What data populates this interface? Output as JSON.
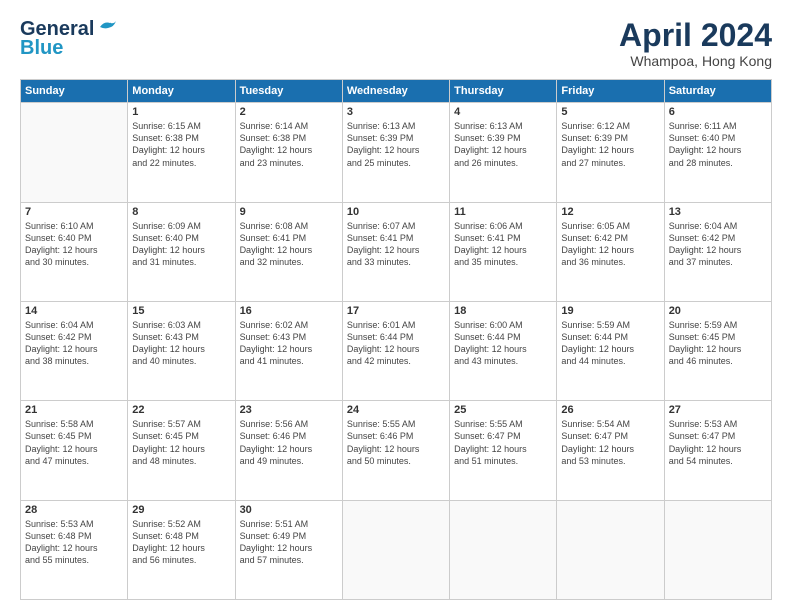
{
  "header": {
    "logo_line1": "General",
    "logo_line2": "Blue",
    "month": "April 2024",
    "location": "Whampoa, Hong Kong"
  },
  "weekdays": [
    "Sunday",
    "Monday",
    "Tuesday",
    "Wednesday",
    "Thursday",
    "Friday",
    "Saturday"
  ],
  "weeks": [
    [
      {
        "day": "",
        "info": ""
      },
      {
        "day": "1",
        "info": "Sunrise: 6:15 AM\nSunset: 6:38 PM\nDaylight: 12 hours\nand 22 minutes."
      },
      {
        "day": "2",
        "info": "Sunrise: 6:14 AM\nSunset: 6:38 PM\nDaylight: 12 hours\nand 23 minutes."
      },
      {
        "day": "3",
        "info": "Sunrise: 6:13 AM\nSunset: 6:39 PM\nDaylight: 12 hours\nand 25 minutes."
      },
      {
        "day": "4",
        "info": "Sunrise: 6:13 AM\nSunset: 6:39 PM\nDaylight: 12 hours\nand 26 minutes."
      },
      {
        "day": "5",
        "info": "Sunrise: 6:12 AM\nSunset: 6:39 PM\nDaylight: 12 hours\nand 27 minutes."
      },
      {
        "day": "6",
        "info": "Sunrise: 6:11 AM\nSunset: 6:40 PM\nDaylight: 12 hours\nand 28 minutes."
      }
    ],
    [
      {
        "day": "7",
        "info": "Sunrise: 6:10 AM\nSunset: 6:40 PM\nDaylight: 12 hours\nand 30 minutes."
      },
      {
        "day": "8",
        "info": "Sunrise: 6:09 AM\nSunset: 6:40 PM\nDaylight: 12 hours\nand 31 minutes."
      },
      {
        "day": "9",
        "info": "Sunrise: 6:08 AM\nSunset: 6:41 PM\nDaylight: 12 hours\nand 32 minutes."
      },
      {
        "day": "10",
        "info": "Sunrise: 6:07 AM\nSunset: 6:41 PM\nDaylight: 12 hours\nand 33 minutes."
      },
      {
        "day": "11",
        "info": "Sunrise: 6:06 AM\nSunset: 6:41 PM\nDaylight: 12 hours\nand 35 minutes."
      },
      {
        "day": "12",
        "info": "Sunrise: 6:05 AM\nSunset: 6:42 PM\nDaylight: 12 hours\nand 36 minutes."
      },
      {
        "day": "13",
        "info": "Sunrise: 6:04 AM\nSunset: 6:42 PM\nDaylight: 12 hours\nand 37 minutes."
      }
    ],
    [
      {
        "day": "14",
        "info": "Sunrise: 6:04 AM\nSunset: 6:42 PM\nDaylight: 12 hours\nand 38 minutes."
      },
      {
        "day": "15",
        "info": "Sunrise: 6:03 AM\nSunset: 6:43 PM\nDaylight: 12 hours\nand 40 minutes."
      },
      {
        "day": "16",
        "info": "Sunrise: 6:02 AM\nSunset: 6:43 PM\nDaylight: 12 hours\nand 41 minutes."
      },
      {
        "day": "17",
        "info": "Sunrise: 6:01 AM\nSunset: 6:44 PM\nDaylight: 12 hours\nand 42 minutes."
      },
      {
        "day": "18",
        "info": "Sunrise: 6:00 AM\nSunset: 6:44 PM\nDaylight: 12 hours\nand 43 minutes."
      },
      {
        "day": "19",
        "info": "Sunrise: 5:59 AM\nSunset: 6:44 PM\nDaylight: 12 hours\nand 44 minutes."
      },
      {
        "day": "20",
        "info": "Sunrise: 5:59 AM\nSunset: 6:45 PM\nDaylight: 12 hours\nand 46 minutes."
      }
    ],
    [
      {
        "day": "21",
        "info": "Sunrise: 5:58 AM\nSunset: 6:45 PM\nDaylight: 12 hours\nand 47 minutes."
      },
      {
        "day": "22",
        "info": "Sunrise: 5:57 AM\nSunset: 6:45 PM\nDaylight: 12 hours\nand 48 minutes."
      },
      {
        "day": "23",
        "info": "Sunrise: 5:56 AM\nSunset: 6:46 PM\nDaylight: 12 hours\nand 49 minutes."
      },
      {
        "day": "24",
        "info": "Sunrise: 5:55 AM\nSunset: 6:46 PM\nDaylight: 12 hours\nand 50 minutes."
      },
      {
        "day": "25",
        "info": "Sunrise: 5:55 AM\nSunset: 6:47 PM\nDaylight: 12 hours\nand 51 minutes."
      },
      {
        "day": "26",
        "info": "Sunrise: 5:54 AM\nSunset: 6:47 PM\nDaylight: 12 hours\nand 53 minutes."
      },
      {
        "day": "27",
        "info": "Sunrise: 5:53 AM\nSunset: 6:47 PM\nDaylight: 12 hours\nand 54 minutes."
      }
    ],
    [
      {
        "day": "28",
        "info": "Sunrise: 5:53 AM\nSunset: 6:48 PM\nDaylight: 12 hours\nand 55 minutes."
      },
      {
        "day": "29",
        "info": "Sunrise: 5:52 AM\nSunset: 6:48 PM\nDaylight: 12 hours\nand 56 minutes."
      },
      {
        "day": "30",
        "info": "Sunrise: 5:51 AM\nSunset: 6:49 PM\nDaylight: 12 hours\nand 57 minutes."
      },
      {
        "day": "",
        "info": ""
      },
      {
        "day": "",
        "info": ""
      },
      {
        "day": "",
        "info": ""
      },
      {
        "day": "",
        "info": ""
      }
    ]
  ]
}
